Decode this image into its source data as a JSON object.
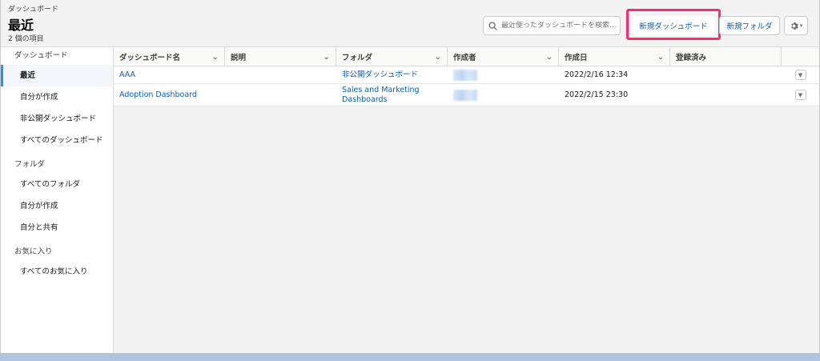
{
  "header": {
    "breadcrumb": "ダッシュボード",
    "title": "最近",
    "item_count": "2 個の項目",
    "search_placeholder": "最近使ったダッシュボードを検索...",
    "new_dashboard_label": "新規ダッシュボード",
    "new_folder_label": "新規フォルダ",
    "highlight_color": "#ff2a6d"
  },
  "sidebar": {
    "dashboards_heading": "ダッシュボード",
    "dashboard_items": [
      {
        "label": "最近"
      },
      {
        "label": "自分が作成"
      },
      {
        "label": "非公開ダッシュボード"
      },
      {
        "label": "すべてのダッシュボード"
      }
    ],
    "folders_heading": "フォルダ",
    "folder_items": [
      {
        "label": "すべてのフォルダ"
      },
      {
        "label": "自分が作成"
      },
      {
        "label": "自分と共有"
      }
    ],
    "favorites_heading": "お気に入り",
    "favorite_items": [
      {
        "label": "すべてのお気に入り"
      }
    ]
  },
  "table": {
    "columns": [
      "ダッシュボード名",
      "説明",
      "フォルダ",
      "作成者",
      "作成日",
      "登録済み"
    ],
    "rows": [
      {
        "name": "AAA",
        "description": "",
        "folder": "非公開ダッシュボード",
        "created_date": "2022/2/16 12:34",
        "subscribed": ""
      },
      {
        "name": "Adoption Dashboard",
        "description": "",
        "folder": "Sales and Marketing Dashboards",
        "created_date": "2022/2/15 23:30",
        "subscribed": ""
      }
    ]
  },
  "colors": {
    "link": "#0b5cab",
    "active_bar": "#1b96ff"
  }
}
